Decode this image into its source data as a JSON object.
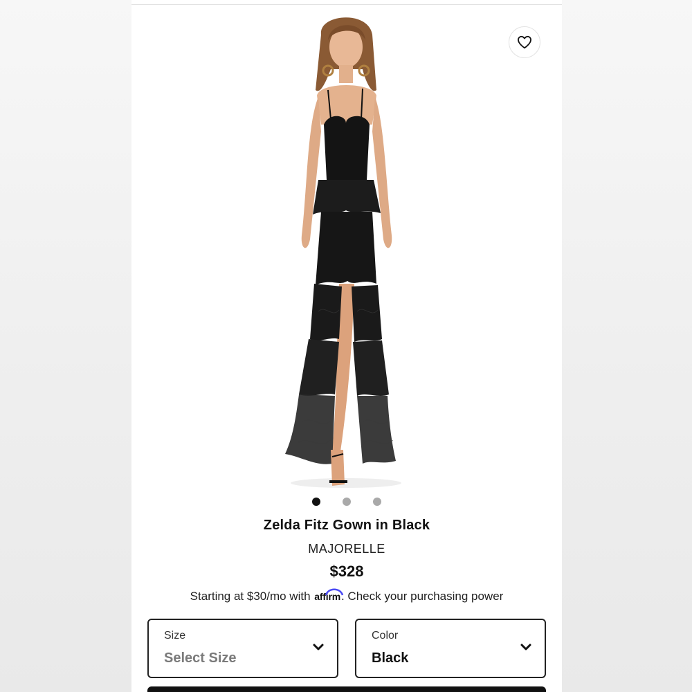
{
  "product": {
    "title": "Zelda Fitz Gown in Black",
    "brand": "MAJORELLE",
    "price": "$328"
  },
  "financing": {
    "prefix": "Starting at $30/mo with",
    "provider": "affirm",
    "suffix": ". Check your purchasing power"
  },
  "gallery": {
    "image_count": 3,
    "active_index": 0
  },
  "size_select": {
    "label": "Size",
    "value": "Select Size"
  },
  "color_select": {
    "label": "Color",
    "value": "Black"
  },
  "icons": {
    "favorite": "heart-icon",
    "dropdown": "chevron-down-icon"
  },
  "colors": {
    "accent_dark": "#111111",
    "dot_inactive": "#a9a9a9",
    "placeholder_gray": "#7a7a7a",
    "affirm_blue": "#4a4af4"
  }
}
